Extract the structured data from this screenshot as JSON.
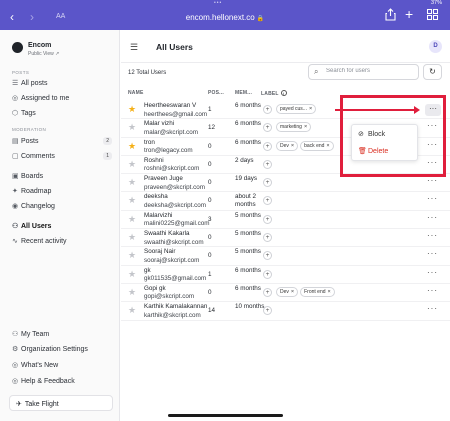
{
  "browser": {
    "dots": "•••",
    "battery": "37%",
    "aa_label": "AA",
    "url": "encom.hellonext.co",
    "back_icon": "chevron-left-icon",
    "forward_icon": "chevron-right-icon",
    "share_icon": "share-icon",
    "new_tab_icon": "plus-icon",
    "tabs_icon": "tabs-grid-icon",
    "theme_color": "#5b55c9"
  },
  "sidebar": {
    "brand_name": "Encom",
    "brand_sub": "Public View",
    "section_posts": "POSTS",
    "section_moderation": "MODERATION",
    "items": [
      {
        "label": "All posts",
        "icon": "layers-icon"
      },
      {
        "label": "Assigned to me",
        "icon": "user-check-icon"
      },
      {
        "label": "Tags",
        "icon": "tag-icon"
      },
      {
        "label": "Posts",
        "icon": "clipboard-icon",
        "count": "2"
      },
      {
        "label": "Comments",
        "icon": "comment-icon",
        "count": "1"
      },
      {
        "label": "Boards",
        "icon": "board-icon"
      },
      {
        "label": "Roadmap",
        "icon": "roadmap-icon"
      },
      {
        "label": "Changelog",
        "icon": "changelog-icon"
      },
      {
        "label": "All Users",
        "icon": "users-icon",
        "active": true
      },
      {
        "label": "Recent activity",
        "icon": "activity-icon"
      },
      {
        "label": "My Team",
        "icon": "team-icon"
      },
      {
        "label": "Organization Settings",
        "icon": "gear-icon"
      },
      {
        "label": "What's New",
        "icon": "sparkle-icon"
      },
      {
        "label": "Help & Feedback",
        "icon": "help-icon"
      }
    ],
    "take_flight": "Take Flight"
  },
  "main": {
    "title": "All Users",
    "avatar_initial": "D",
    "total_users": "12 Total Users",
    "search_placeholder": "Search for users",
    "columns": {
      "name": "NAME",
      "posts": "POS...",
      "member": "MEM...",
      "label": "LABEL"
    },
    "users": [
      {
        "name": "Heertheeswaran V",
        "email": "heerthees@gmail.com",
        "posts": "1",
        "member": "6 months",
        "starred": true,
        "labels": [
          "payed cus..."
        ]
      },
      {
        "name": "Malar vizhi",
        "email": "malar@skcript.com",
        "posts": "12",
        "member": "6 months",
        "starred": false,
        "labels": [
          "marketing"
        ]
      },
      {
        "name": "tron",
        "email": "tron@legacy.com",
        "posts": "0",
        "member": "6 months",
        "starred": true,
        "labels": [
          "Dev",
          "back end"
        ]
      },
      {
        "name": "Roshni",
        "email": "roshni@skcript.com",
        "posts": "0",
        "member": "2 days",
        "starred": false,
        "labels": []
      },
      {
        "name": "Praveen Juge",
        "email": "praveen@skcript.com",
        "posts": "0",
        "member": "19 days",
        "starred": false,
        "labels": []
      },
      {
        "name": "deeksha",
        "email": "deeksha@skcript.com",
        "posts": "0",
        "member": "about 2 months",
        "starred": false,
        "labels": []
      },
      {
        "name": "Malarvizhi",
        "email": "malini0225@gmail.com",
        "posts": "3",
        "member": "5 months",
        "starred": false,
        "labels": []
      },
      {
        "name": "Swaathi Kakarla",
        "email": "swaathi@skcript.com",
        "posts": "0",
        "member": "5 months",
        "starred": false,
        "labels": []
      },
      {
        "name": "Sooraj Nair",
        "email": "sooraj@skcript.com",
        "posts": "0",
        "member": "5 months",
        "starred": false,
        "labels": []
      },
      {
        "name": "gk",
        "email": "gk011535@gmail.com",
        "posts": "1",
        "member": "6 months",
        "starred": false,
        "labels": []
      },
      {
        "name": "Gopi gk",
        "email": "gopi@skcript.com",
        "posts": "0",
        "member": "6 months",
        "starred": false,
        "labels": [
          "Dev",
          "Front end"
        ]
      },
      {
        "name": "Karthik Kamalakannan",
        "email": "karthik@skcript.com",
        "posts": "14",
        "member": "10 months",
        "starred": false,
        "labels": []
      }
    ],
    "more_label": "···"
  },
  "menu": {
    "block": "Block",
    "delete": "Delete",
    "delete_color": "#d92d20",
    "annotation_color": "#e01e3c"
  }
}
